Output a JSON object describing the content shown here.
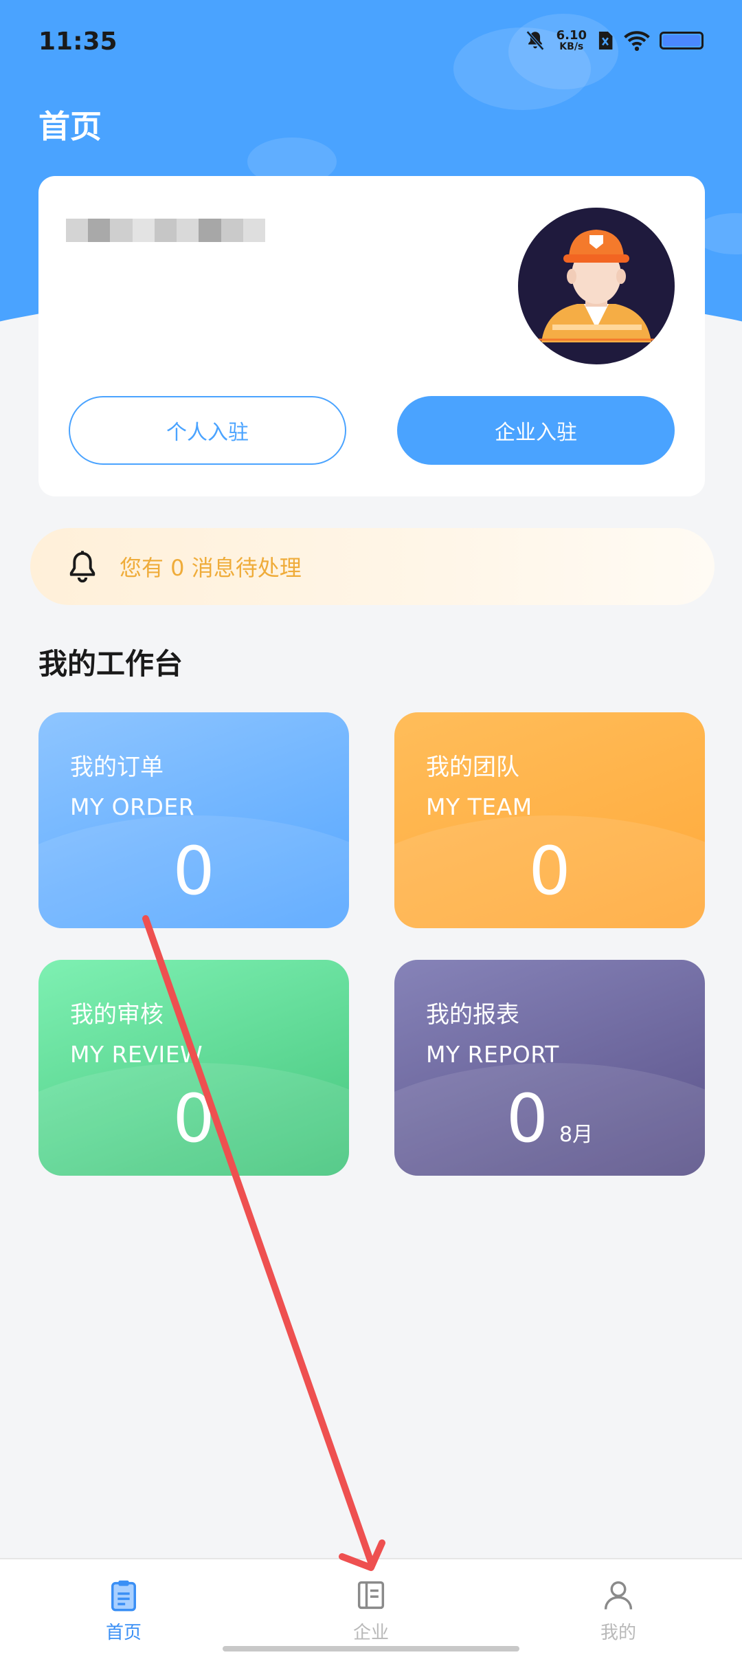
{
  "status_bar": {
    "time": "11:35",
    "net_speed_value": "6.10",
    "net_speed_unit": "KB/s",
    "icons": [
      "bell-muted-icon",
      "sim-icon",
      "wifi-icon",
      "battery-icon"
    ]
  },
  "header": {
    "title": "首页"
  },
  "profile": {
    "avatar": "worker-avatar",
    "buttons": {
      "personal_join": "个人入驻",
      "enterprise_join": "企业入驻"
    }
  },
  "notice": {
    "icon": "bell-icon",
    "text": "您有 0 消息待处理"
  },
  "workbench": {
    "title": "我的工作台",
    "tiles": [
      {
        "title_cn": "我的订单",
        "title_en": "MY ORDER",
        "count": "0",
        "color": "#55a6ff"
      },
      {
        "title_cn": "我的团队",
        "title_en": "MY TEAM",
        "count": "0",
        "color": "#ffa93a"
      },
      {
        "title_cn": "我的审核",
        "title_en": "MY REVIEW",
        "count": "0",
        "color": "#45c57d"
      },
      {
        "title_cn": "我的报表",
        "title_en": "MY REPORT",
        "count": "0",
        "suffix": "8月",
        "color": "#5a5289"
      }
    ]
  },
  "bottom_nav": {
    "items": [
      {
        "label": "首页",
        "icon": "clipboard-icon",
        "active": true
      },
      {
        "label": "企业",
        "icon": "enterprise-icon",
        "active": false
      },
      {
        "label": "我的",
        "icon": "user-icon",
        "active": false
      }
    ]
  },
  "colors": {
    "primary": "#4aa3ff",
    "notice_text": "#efac3a",
    "nav_active": "#3a8ff5",
    "annotation": "#ee5050"
  }
}
